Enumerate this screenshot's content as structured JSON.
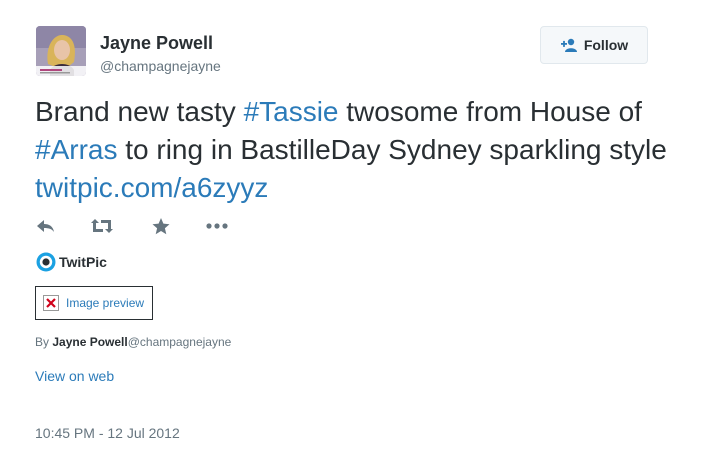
{
  "author": {
    "name": "Jayne Powell",
    "handle": "@champagnejayne",
    "avatar_caption": "Champagne Jayne"
  },
  "follow_button": {
    "label": "Follow"
  },
  "tweet": {
    "segments": [
      {
        "text": "Brand new tasty ",
        "link": false
      },
      {
        "text": "#Tassie",
        "link": true
      },
      {
        "text": " twosome from House of ",
        "link": false
      },
      {
        "text": "#Arras",
        "link": true
      },
      {
        "text": " to ring in BastilleDay Sydney sparkling style ",
        "link": false
      },
      {
        "text": "twitpic.com/a6zyyz",
        "link": true
      }
    ]
  },
  "actions": [
    {
      "name": "reply-icon"
    },
    {
      "name": "retweet-icon"
    },
    {
      "name": "favorite-icon"
    },
    {
      "name": "more-icon"
    }
  ],
  "card": {
    "provider": "TwitPic",
    "provider_icon": "twitpic-icon",
    "image_preview_label": "Image preview",
    "broken_image_icon": "broken-image-icon",
    "byline_prefix": "By ",
    "byline_name": "Jayne Powell",
    "byline_handle": "@champagnejayne"
  },
  "view_on_web": "View on web",
  "timestamp": "10:45 PM - 12 Jul 2012",
  "colors": {
    "link": "#2b7bb9",
    "text": "#292f33",
    "muted": "#66757f",
    "broken_icon": "#d0021b"
  }
}
